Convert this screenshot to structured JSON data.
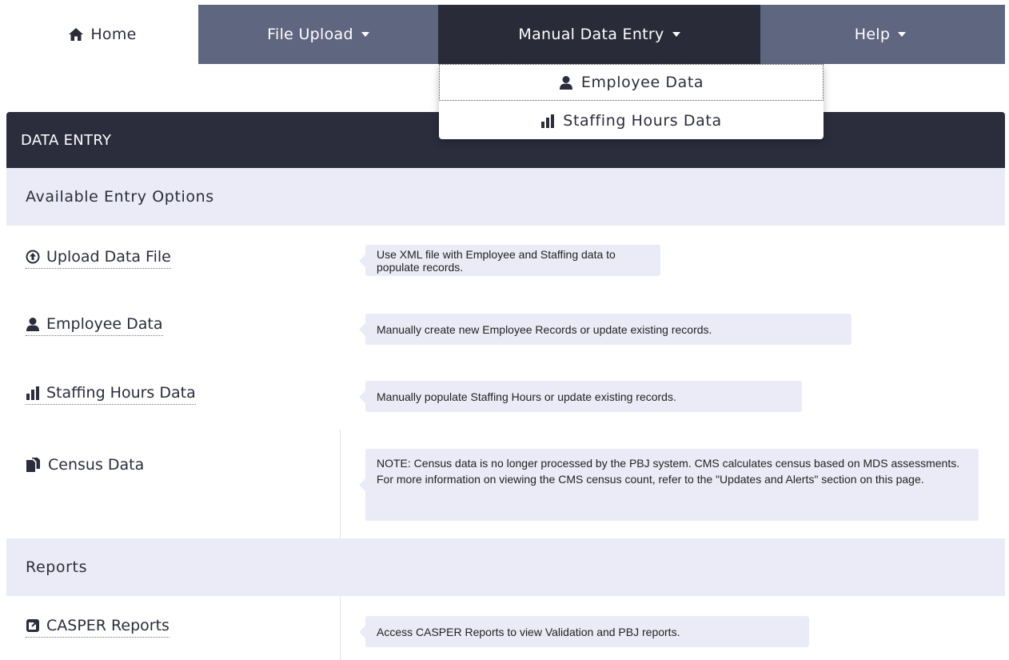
{
  "nav": {
    "home": "Home",
    "file_upload": "File Upload",
    "manual_entry": "Manual Data Entry",
    "help": "Help"
  },
  "dropdown": {
    "items": [
      "Employee Data",
      "Staffing Hours Data"
    ]
  },
  "panel": {
    "title": "DATA ENTRY",
    "sections": {
      "entry_options": "Available Entry Options",
      "reports": "Reports"
    },
    "rows": [
      {
        "label": "Upload Data File",
        "icon": "upload-circle-icon",
        "desc": "Use XML file with Employee and Staffing data to populate records."
      },
      {
        "label": "Employee Data",
        "icon": "user-icon",
        "desc": "Manually create new Employee Records or update existing records."
      },
      {
        "label": "Staffing Hours Data",
        "icon": "bar-chart-icon",
        "desc": "Manually populate Staffing Hours or update existing records."
      },
      {
        "label": "Census Data",
        "icon": "documents-icon",
        "desc": "NOTE: Census data is no longer processed by the PBJ system. CMS calculates census based on MDS assessments. For more information on viewing the CMS census count, refer to the \"Updates and Alerts\" section on this page."
      },
      {
        "label": "CASPER Reports",
        "icon": "external-link-icon",
        "desc": "Access CASPER Reports to view Validation and PBJ reports."
      }
    ]
  },
  "colors": {
    "nav_bg": "#5f6680",
    "nav_active": "#2a2b39",
    "panel_header": "#2c2d3c",
    "section_bg": "#ebebf7"
  }
}
